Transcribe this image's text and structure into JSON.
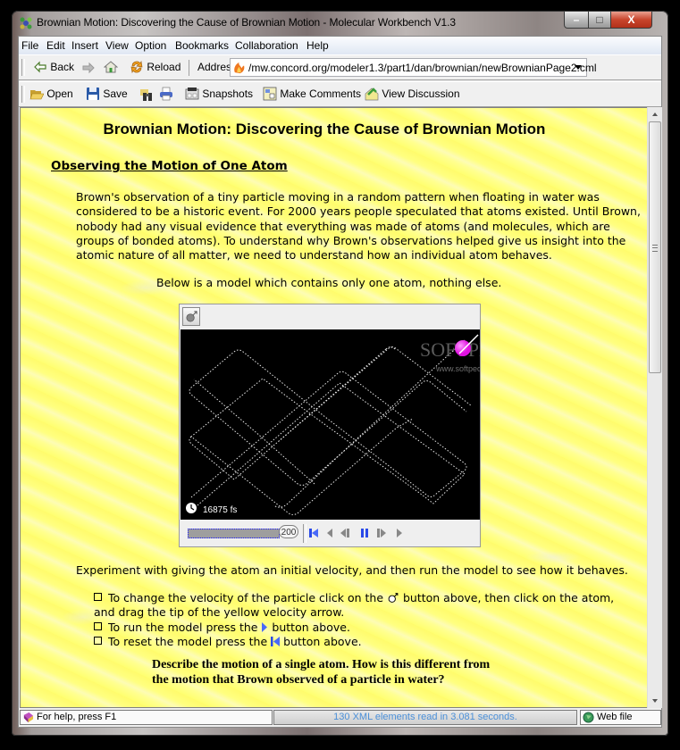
{
  "window": {
    "title": "Brownian Motion: Discovering the Cause of Brownian Motion - Molecular Workbench V1.3",
    "controls": {
      "minimize": "–",
      "maximize": "□",
      "close": "X"
    }
  },
  "menu": [
    "File",
    "Edit",
    "Insert",
    "View",
    "Option",
    "Bookmarks",
    "Collaboration",
    "Help"
  ],
  "nav_toolbar": {
    "back": "Back",
    "reload": "Reload",
    "address_label": "Address",
    "address_value": "/mw.concord.org/modeler1.3/part1/dan/brownian/newBrownianPage2.cml"
  },
  "file_toolbar": {
    "open": "Open",
    "save": "Save",
    "snapshots": "Snapshots",
    "make_comments": "Make Comments",
    "view_discussion": "View Discussion"
  },
  "page": {
    "title": "Brownian Motion: Discovering the Cause of Brownian Motion",
    "section_heading": "Observing the Motion of One Atom",
    "paragraph": "Brown's observation of a tiny particle moving in a random pattern when floating in water was considered to be a historic event. For 2000 years people speculated that atoms existed. Until Brown, nobody had any visual evidence that everything was made of atoms (and molecules, which are groups of bonded atoms). To understand why Brown's observations helped give us insight into the atomic nature of all matter, we need to understand how an individual atom behaves.",
    "model_intro": "Below is a model which contains only one atom, nothing else.",
    "experiment": "Experiment with giving the atom an initial velocity, and then run the model to see how it behaves.",
    "bullets": [
      {
        "pre": "To change the velocity of the particle click on the ",
        "post": " button above, then click on the atom, and drag the tip of the yellow velocity arrow."
      },
      {
        "pre": "To run the model press the ",
        "post": " button above."
      },
      {
        "pre": "To reset the model press the ",
        "post": " button above."
      }
    ],
    "question_line1": "Describe the motion of a single atom. How is this different from",
    "question_line2": "the motion that Brown observed of a particle in water?"
  },
  "model": {
    "time_label": "16875 fs",
    "slider_value": "200",
    "slider_fill_fraction": 1.0,
    "atom_color": "#e010e0",
    "watermark_main": "SOFTPEDIA",
    "watermark_sub": "www.softpedia.com"
  },
  "scrollbar": {
    "position_fraction": 0.0,
    "visible_fraction": 0.44
  },
  "status": {
    "help": "For help, press F1",
    "message": "130 XML elements read in 3.081 seconds.",
    "source": "Web file"
  }
}
